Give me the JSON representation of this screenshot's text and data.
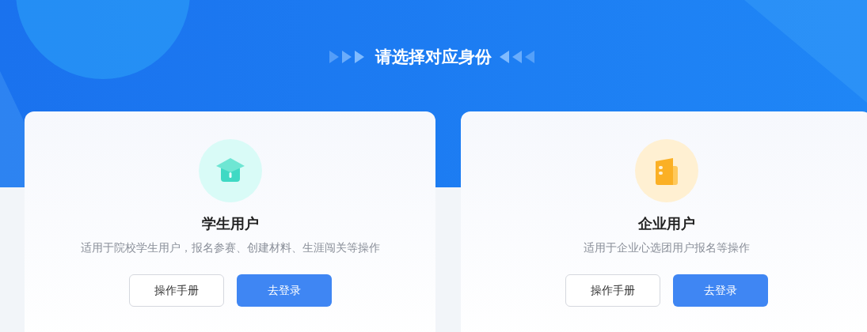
{
  "heading": "请选择对应身份",
  "cards": [
    {
      "kind": "student",
      "title": "学生用户",
      "description": "适用于院校学生用户，报名参赛、创建材料、生涯闯关等操作",
      "buttons": [
        "操作手册",
        "去登录"
      ]
    },
    {
      "kind": "enterprise",
      "title": "企业用户",
      "description": "适用于企业心选团用户报名等操作",
      "buttons": [
        "操作手册",
        "去登录"
      ]
    }
  ]
}
